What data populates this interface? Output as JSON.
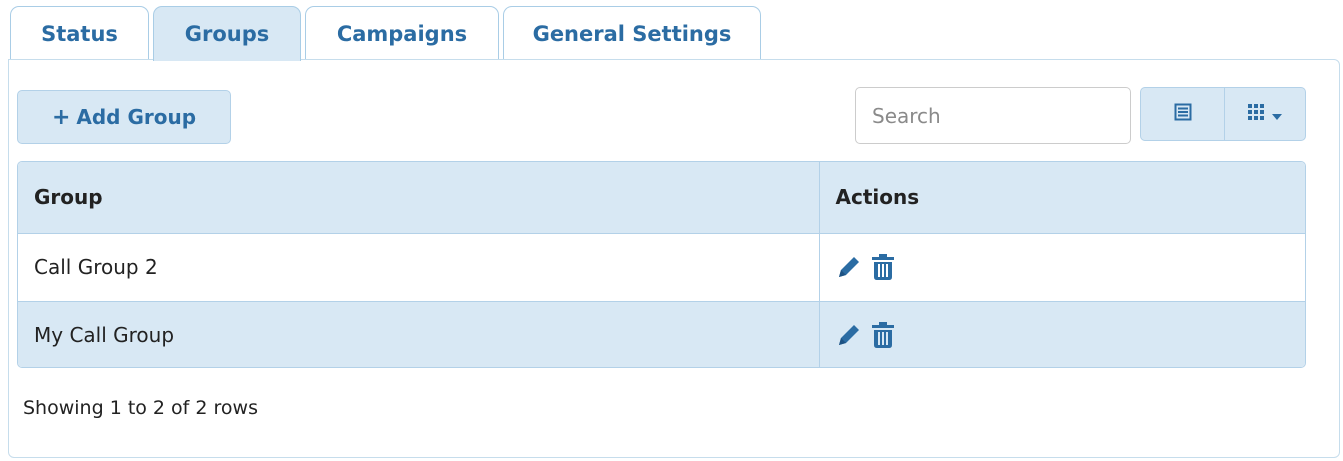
{
  "tabs": [
    {
      "label": "Status",
      "active": false
    },
    {
      "label": "Groups",
      "active": true
    },
    {
      "label": "Campaigns",
      "active": false
    },
    {
      "label": "General Settings",
      "active": false
    }
  ],
  "toolbar": {
    "add_label": "Add Group",
    "add_icon": "plus-icon",
    "search_placeholder": "Search",
    "search_value": "",
    "view_toggle_icon": "list-view-icon",
    "columns_icon": "columns-grid-icon",
    "columns_dropdown_icon": "caret-down-icon"
  },
  "table": {
    "columns": [
      "Group",
      "Actions"
    ],
    "rows": [
      {
        "group": "Call Group 2",
        "actions": [
          "pencil-icon",
          "trash-icon"
        ]
      },
      {
        "group": "My Call Group",
        "actions": [
          "pencil-icon",
          "trash-icon"
        ]
      }
    ]
  },
  "footer": {
    "pagination_text": "Showing 1 to 2 of 2 rows"
  },
  "colors": {
    "accent": "#2b6ca3",
    "header_bg": "#d8e8f4",
    "border": "#b3d1e8"
  }
}
